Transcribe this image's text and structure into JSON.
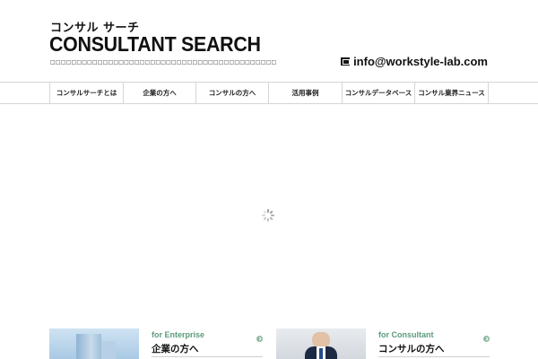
{
  "header": {
    "logo_sub": "コンサル サーチ",
    "logo_main": "CONSULTANT SEARCH",
    "tagline": "□□□□□□□□□□□□□□□□□□□□□□□□□□□□□□□□□□□□□□□□□□□",
    "email": "info@workstyle-lab.com"
  },
  "nav": {
    "items": [
      {
        "label": "コンサルサーチとは"
      },
      {
        "label": "企業の方へ"
      },
      {
        "label": "コンサルの方へ"
      },
      {
        "label": "活用事例"
      },
      {
        "label": "コンサルデータベース"
      },
      {
        "label": "コンサル業界ニュース"
      }
    ]
  },
  "cards": [
    {
      "en": "for Enterprise",
      "ja": "企業の方へ"
    },
    {
      "en": "for Consultant",
      "ja": "コンサルの方へ"
    }
  ]
}
